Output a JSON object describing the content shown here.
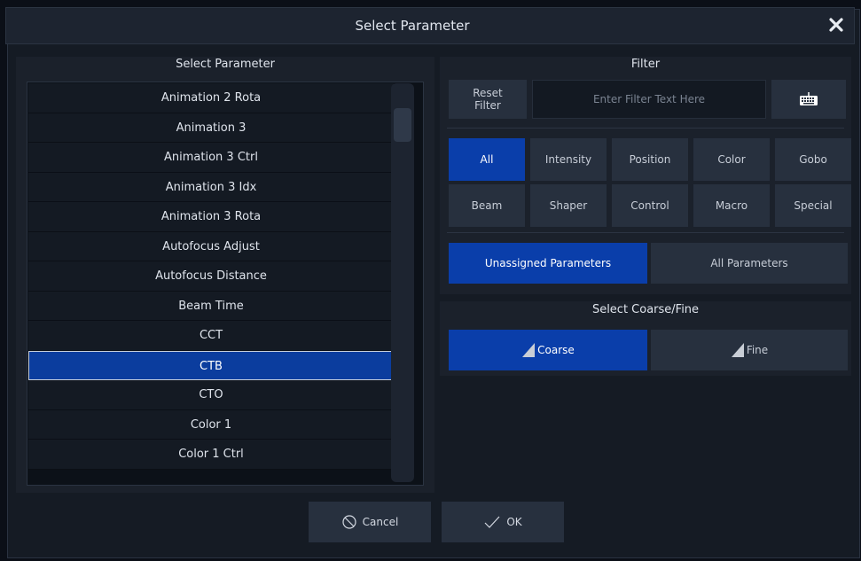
{
  "dialog": {
    "title": "Select Parameter",
    "close_icon": "close-icon"
  },
  "param_panel": {
    "heading": "Select Parameter",
    "items": [
      "Animation 2 Rota",
      "Animation 3",
      "Animation 3 Ctrl",
      "Animation 3 Idx",
      "Animation 3 Rota",
      "Autofocus Adjust",
      "Autofocus Distance",
      "Beam Time",
      "CCT",
      "CTB",
      "CTO",
      "Color 1",
      "Color 1 Ctrl"
    ],
    "selected": "CTB"
  },
  "filter": {
    "heading": "Filter",
    "reset_label": "Reset Filter",
    "input_placeholder": "Enter Filter Text Here",
    "input_value": "",
    "keyboard_icon": "keyboard-icon",
    "categories": [
      "All",
      "Intensity",
      "Position",
      "Color",
      "Gobo",
      "Beam",
      "Shaper",
      "Control",
      "Macro",
      "Special"
    ],
    "active_category": "All",
    "scope_options": [
      "Unassigned Parameters",
      "All Parameters"
    ],
    "active_scope": "Unassigned Parameters"
  },
  "coarse_fine": {
    "heading": "Select Coarse/Fine",
    "options": [
      "Coarse",
      "Fine"
    ],
    "active": "Coarse"
  },
  "footer": {
    "cancel_label": "Cancel",
    "ok_label": "OK"
  },
  "colors": {
    "accent": "#0a3eaa",
    "selection": "#0b3d9e",
    "panel": "#1b212b",
    "button": "#27303e"
  }
}
